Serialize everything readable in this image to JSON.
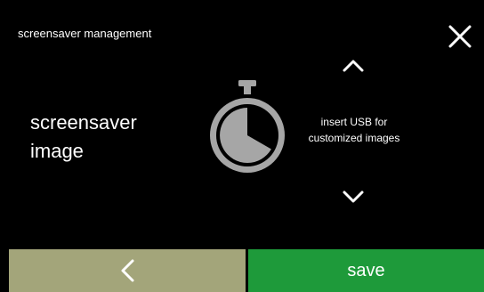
{
  "header": {
    "title": "screensaver management",
    "close_icon": "close-icon"
  },
  "setting": {
    "label_line1": "screensaver",
    "label_line2": "image"
  },
  "navigation": {
    "up_icon": "chevron-up-icon",
    "down_icon": "chevron-down-icon"
  },
  "content": {
    "icon": "stopwatch-icon",
    "message_line1": "insert USB for",
    "message_line2": "customized images"
  },
  "footer": {
    "back_icon": "chevron-left-icon",
    "save_label": "save"
  },
  "colors": {
    "background": "#000000",
    "back_button": "#a3a57a",
    "save_button": "#1e9a3a",
    "icon_fill": "#a6a6a6"
  }
}
